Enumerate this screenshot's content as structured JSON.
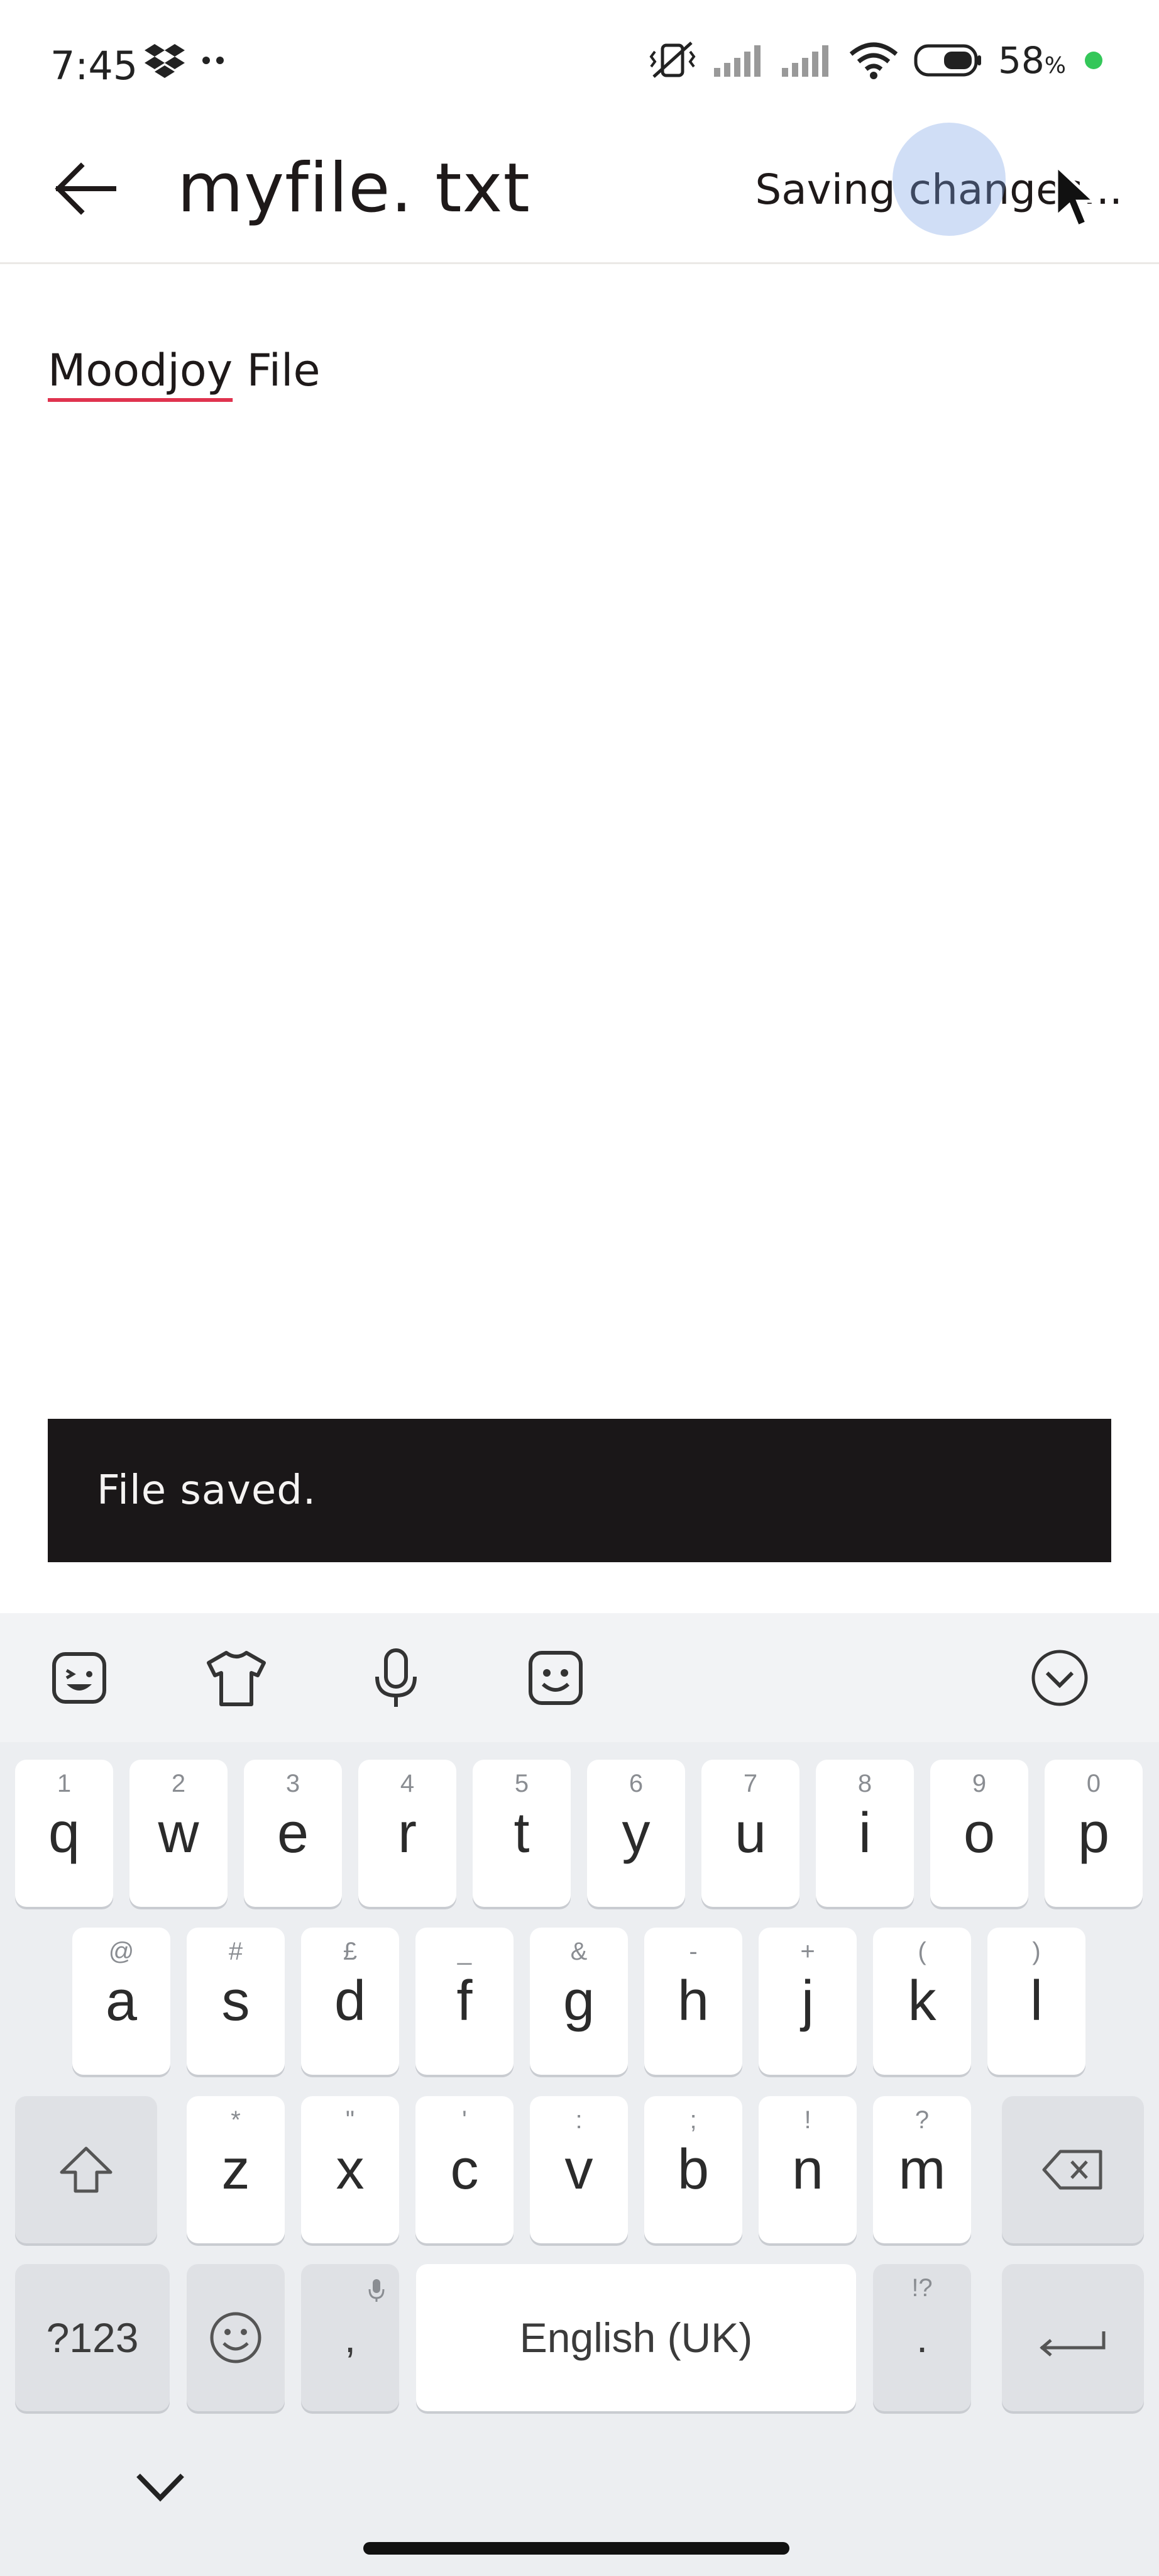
{
  "status_bar": {
    "time": "7:45",
    "battery_percent": "58",
    "battery_unit": "%",
    "left_icons": [
      "dropbox-icon",
      "more-dots-icon"
    ],
    "right_icons": [
      "vibrate-mute-icon",
      "signal-icon",
      "signal-icon",
      "wifi-icon",
      "battery-icon"
    ]
  },
  "header": {
    "back_icon": "arrow-left-icon",
    "file_name": "myfile. txt",
    "status_text": "Saving changes..."
  },
  "document": {
    "misspelled_word": "Moodjoy",
    "rest_text": " File"
  },
  "snackbar": {
    "message": "File saved."
  },
  "keyboard": {
    "toolbar_icons": [
      "sticker-icon",
      "theme-shirt-icon",
      "microphone-icon",
      "emoji-sticker-icon",
      "collapse-keyboard-icon"
    ],
    "row1": [
      {
        "key": "q",
        "hint": "1"
      },
      {
        "key": "w",
        "hint": "2"
      },
      {
        "key": "e",
        "hint": "3"
      },
      {
        "key": "r",
        "hint": "4"
      },
      {
        "key": "t",
        "hint": "5"
      },
      {
        "key": "y",
        "hint": "6"
      },
      {
        "key": "u",
        "hint": "7"
      },
      {
        "key": "i",
        "hint": "8"
      },
      {
        "key": "o",
        "hint": "9"
      },
      {
        "key": "p",
        "hint": "0"
      }
    ],
    "row2": [
      {
        "key": "a",
        "hint": "@"
      },
      {
        "key": "s",
        "hint": "#"
      },
      {
        "key": "d",
        "hint": "£"
      },
      {
        "key": "f",
        "hint": "_"
      },
      {
        "key": "g",
        "hint": "&"
      },
      {
        "key": "h",
        "hint": "-"
      },
      {
        "key": "j",
        "hint": "+"
      },
      {
        "key": "k",
        "hint": "("
      },
      {
        "key": "l",
        "hint": ")"
      }
    ],
    "row3": [
      {
        "key": "z",
        "hint": "*"
      },
      {
        "key": "x",
        "hint": "\""
      },
      {
        "key": "c",
        "hint": "'"
      },
      {
        "key": "v",
        "hint": ":"
      },
      {
        "key": "b",
        "hint": ";"
      },
      {
        "key": "n",
        "hint": "!"
      },
      {
        "key": "m",
        "hint": "?"
      }
    ],
    "symbols_label": "?123",
    "comma_label": ",",
    "space_label": "English (UK)",
    "period_label": ".",
    "period_hint": "!?"
  }
}
